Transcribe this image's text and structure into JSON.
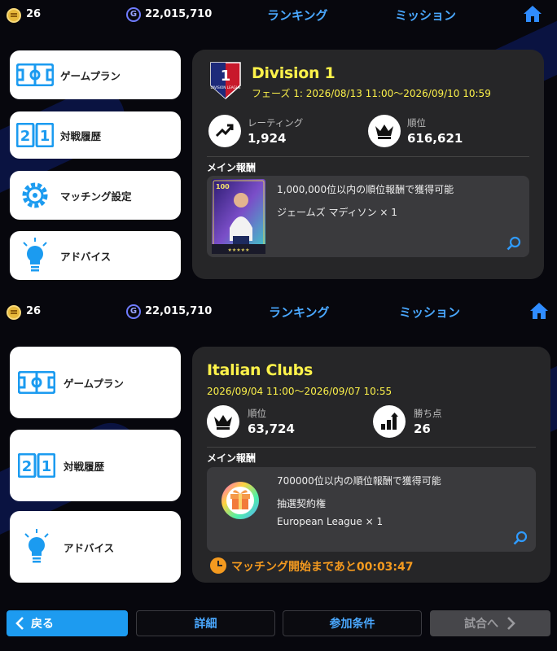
{
  "top": {
    "coins": "26",
    "gp": "22,015,710",
    "gp_symbol": "G",
    "ranking": "ランキング",
    "mission": "ミッション"
  },
  "left_menu_1": [
    {
      "label": "ゲームプラン",
      "icon": "formation-icon"
    },
    {
      "label": "対戦履歴",
      "icon": "scoreboard-icon"
    },
    {
      "label": "マッチング設定",
      "icon": "gear-icon"
    },
    {
      "label": "アドバイス",
      "icon": "lightbulb-icon"
    }
  ],
  "left_menu_2": [
    {
      "label": "ゲームプラン",
      "icon": "formation-icon"
    },
    {
      "label": "対戦履歴",
      "icon": "scoreboard-icon"
    },
    {
      "label": "アドバイス",
      "icon": "lightbulb-icon"
    }
  ],
  "scoreboard_digits": [
    "2",
    "1"
  ],
  "event1": {
    "badge_number": "1",
    "badge_text": "DIVISION LEAGUE",
    "title": "Division 1",
    "period": "フェーズ 1: 2026/08/13 11:00～2026/09/10 10:59",
    "stat1_label": "レーティング",
    "stat1_value": "1,924",
    "stat2_label": "順位",
    "stat2_value": "616,621",
    "reward_heading": "メイン報酬",
    "reward_condition": "1,000,000位以内の順位報酬で獲得可能",
    "reward_item": "ジェームズ マディソン × 1",
    "card_rating": "100"
  },
  "event2": {
    "title": "Italian Clubs",
    "period": "2026/09/04 11:00～2026/09/07 10:55",
    "stat1_label": "順位",
    "stat1_value": "63,724",
    "stat2_label": "勝ち点",
    "stat2_value": "26",
    "reward_heading": "メイン報酬",
    "reward_condition": "700000位以内の順位報酬で獲得可能",
    "reward_item": "抽選契約権",
    "reward_sub": "European League × 1",
    "timer": "マッチング開始まであと00:03:47"
  },
  "bottom": {
    "back": "戻る",
    "details": "詳細",
    "conditions": "参加条件",
    "to_match": "試合へ"
  },
  "colors": {
    "accent_blue": "#4aa8ff",
    "title_yellow": "#fdf24a",
    "timer_orange": "#f49a1f",
    "back_button": "#1d9bf0"
  }
}
